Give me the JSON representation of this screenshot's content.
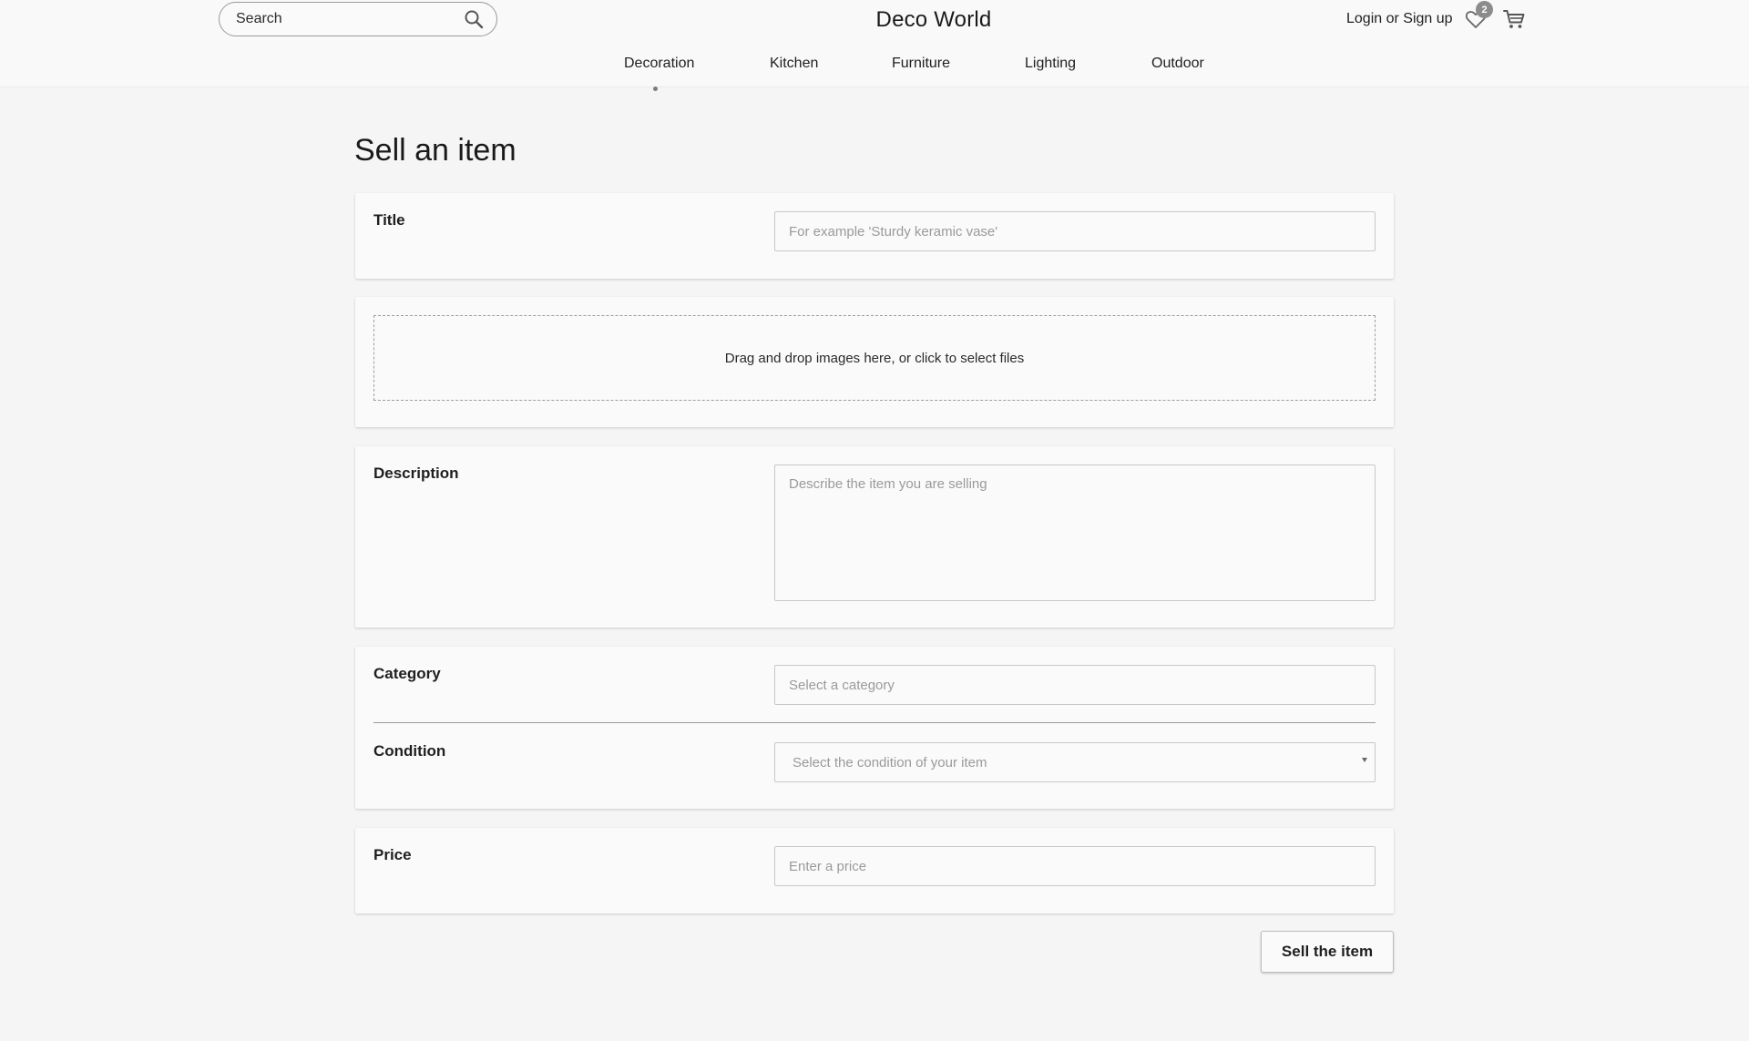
{
  "header": {
    "brand": "Deco World",
    "search_placeholder": "Search",
    "account_link": "Login or Sign up",
    "wishlist_count": "2",
    "icons": {
      "search": "search-icon",
      "wishlist": "heart-icon",
      "cart": "cart-icon"
    }
  },
  "nav": {
    "items": [
      "Decoration",
      "Kitchen",
      "Furniture",
      "Lighting",
      "Outdoor"
    ],
    "active": "Decoration"
  },
  "form": {
    "page_title": "Sell an item",
    "title": {
      "label": "Title",
      "placeholder": "For example 'Sturdy keramic vase'"
    },
    "images": {
      "dropzone_text": "Drag and drop images here, or click to select files"
    },
    "description": {
      "label": "Description",
      "placeholder": "Describe the item you are selling"
    },
    "category": {
      "label": "Category",
      "placeholder": "Select a category"
    },
    "condition": {
      "label": "Condition",
      "placeholder": "Select the condition of your item"
    },
    "price": {
      "label": "Price",
      "placeholder": "Enter a price"
    },
    "submit_label": "Sell the item"
  }
}
